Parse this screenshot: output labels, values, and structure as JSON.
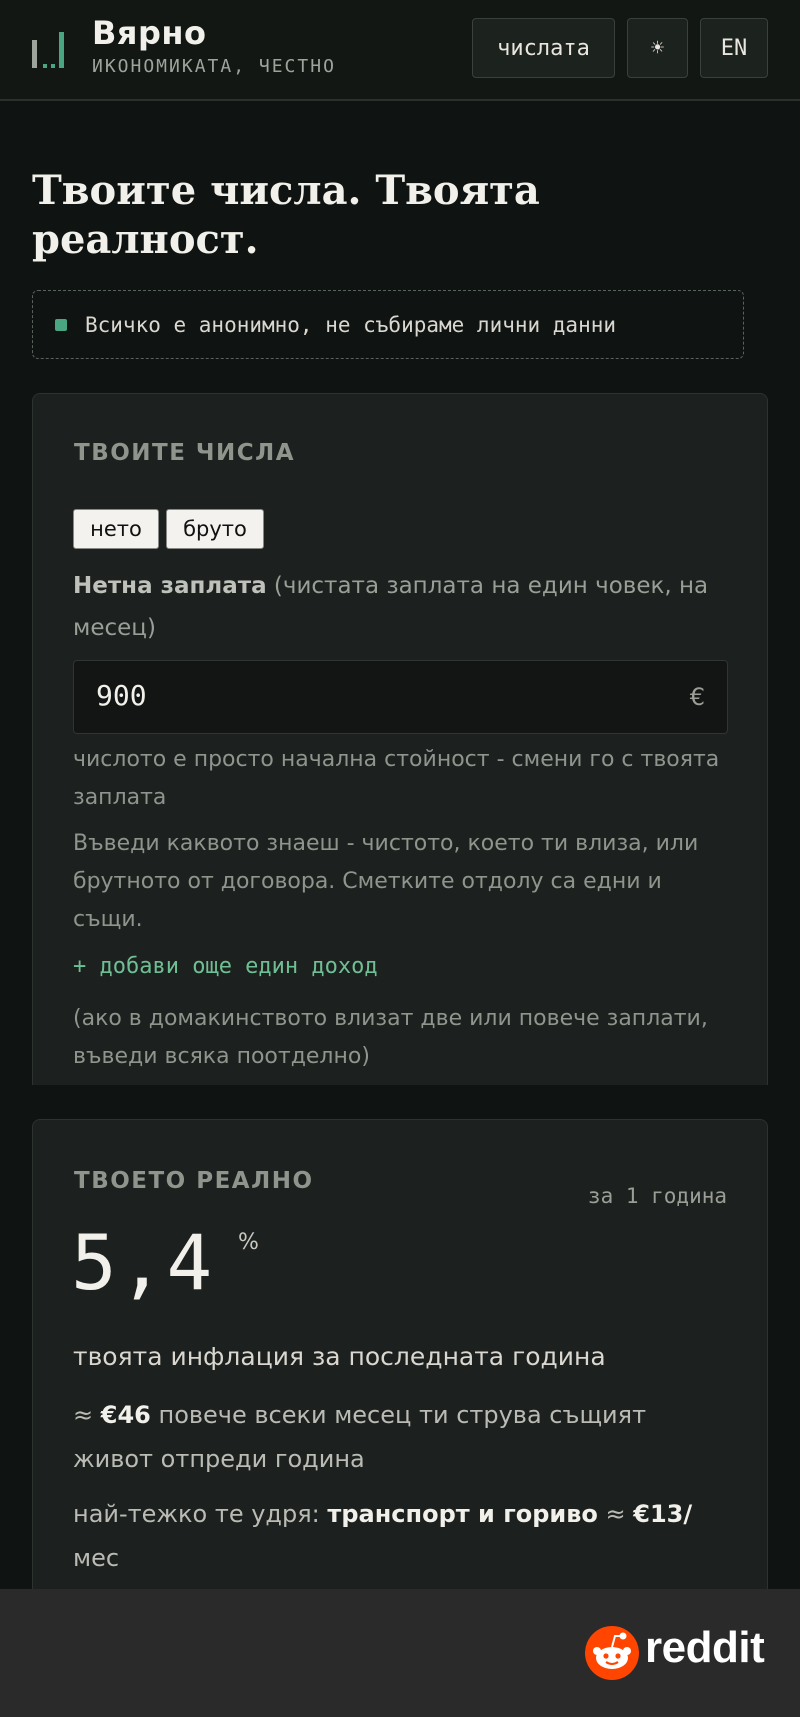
{
  "header": {
    "brand_name": "Вярно",
    "brand_tagline": "ИКОНОМИКАТА, ЧЕСТНО",
    "numbers_button": "числата",
    "theme_icon": "sun-icon",
    "theme_glyph": "☀",
    "language_button": "EN",
    "logo_colors": {
      "bars": "#9ea39c",
      "accent": "#4aa582"
    }
  },
  "hero": {
    "title": "Твоите числа. Твоята реалност.",
    "privacy_note": "Всичко е анонимно, не събираме лични данни"
  },
  "inputs_card": {
    "section_title": "ТВОИТЕ ЧИСЛА",
    "mode_toggle": [
      "нето",
      "бруто"
    ],
    "field_label_bold": "Нетна заплата",
    "field_label_hint": "(чистата заплата на един човек, на месец)",
    "amount_value": "900",
    "currency": "€",
    "hint_default": "числото е просто начална стойност - смени го с твоята заплата",
    "hint_enter": "Въведи каквото знаеш - чистото, което ти влиза, или брутното от договора. Сметките отдолу са едни и същи.",
    "add_income": "+ добави още един доход",
    "add_income_hint": "(ако в домакинството влизат две или повече заплати, въведи всяка поотделно)"
  },
  "result_card": {
    "section_title": "ТВОЕТО РЕАЛНО",
    "period": "за 1 година",
    "inflation_value": "5,4",
    "inflation_unit": "%",
    "inflation_caption": "твоята инфлация за последната година",
    "monthly_prefix": "≈",
    "monthly_amount": "€46",
    "monthly_text": "повече всеки месец ти струва същият живот отпреди година",
    "hardest_prefix": "най-тежко те удря:",
    "hardest_category": "транспорт и гориво",
    "hardest_approx": "≈",
    "hardest_amount": "€13/",
    "hardest_unit": "мес"
  },
  "footer": {
    "brand": "reddit",
    "brand_icon": "reddit-logo-icon",
    "brand_color": "#ff4500"
  },
  "colors": {
    "background": "#0f1311",
    "card": "#1c201e",
    "accent_green": "#6fbf94"
  }
}
